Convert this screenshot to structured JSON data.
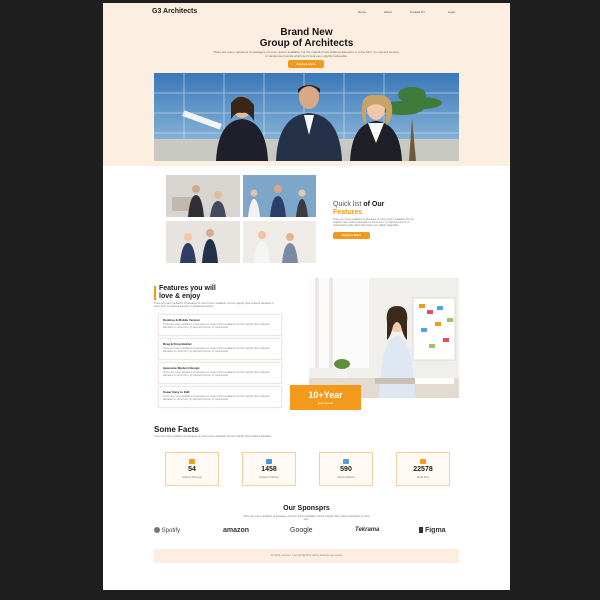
{
  "nav": {
    "brand": "G3 Architects",
    "links": [
      "Home",
      "About",
      "Contact Us",
      "Login"
    ]
  },
  "hero": {
    "title_line1": "Brand New",
    "title_line2": "Group of Architects",
    "subtitle": "There are many variations of passages of Lorem Ipsum available, but the majority have suffered alteration in some form, by injected humour, or randomised words which don't look even slightly believable.",
    "button": "Explore More"
  },
  "quick": {
    "title_a": "Quick list",
    "title_b": "of Our",
    "title_c": "Features",
    "text": "There are many variations of passages of Lorem Ipsum available, but the majority have suffered alteration in some form, by injected humour, or randomised words which don't look even slightly believable.",
    "button": "Explore More"
  },
  "features": {
    "title_line1": "Features you will",
    "title_line2": "love & enjoy",
    "intro": "There are many variations of passages of Lorem Ipsum available, but the majority have suffered alteration in some form, by injected humour, or randomised words.",
    "items": [
      {
        "title": "Desktop & Mobile Version",
        "desc": "There are many variations of passages of Lorem Ipsum available, but the majority have suffered alteration in some form, by injected humour, or randomised."
      },
      {
        "title": "Drag & Drop Builder",
        "desc": "There are many variations of passages of Lorem Ipsum available, but the majority have suffered alteration in some form, by injected humour, or randomised."
      },
      {
        "title": "Awesome Modern Design",
        "desc": "There are many variations of passages of Lorem Ipsum available, but the majority have suffered alteration in some form, by injected humour, or randomised."
      },
      {
        "title": "Super Easy to Edit",
        "desc": "There are many variations of passages of Lorem Ipsum available, but the majority have suffered alteration in some form, by injected humour, or randomised."
      }
    ],
    "badge_number": "10+Year",
    "badge_label": "Experience"
  },
  "facts": {
    "title": "Some Facts",
    "intro": "There are many variations of passages of Lorem Ipsum available, but the majority have suffered alteration.",
    "items": [
      {
        "number": "54",
        "label": "Awards Winnings"
      },
      {
        "number": "1458",
        "label": "Projects Finished"
      },
      {
        "number": "590",
        "label": "Clients Worked"
      },
      {
        "number": "22578",
        "label": "Email Sent"
      }
    ]
  },
  "sponsors": {
    "title": "Our Sponsprs",
    "intro": "There are many variations of passages of Lorem Ipsum available, but the majority have suffered alteration in some form.",
    "logos": [
      "Spotify",
      "amazon",
      "Google",
      "Tekrama",
      "Figma"
    ]
  },
  "footer": {
    "text": "All rights reserved. Copyright@2023 startup landing page design"
  },
  "colors": {
    "accent": "#f39a1c",
    "hero_bg": "#fcefe1",
    "page_bg": "#1f1f1f"
  }
}
